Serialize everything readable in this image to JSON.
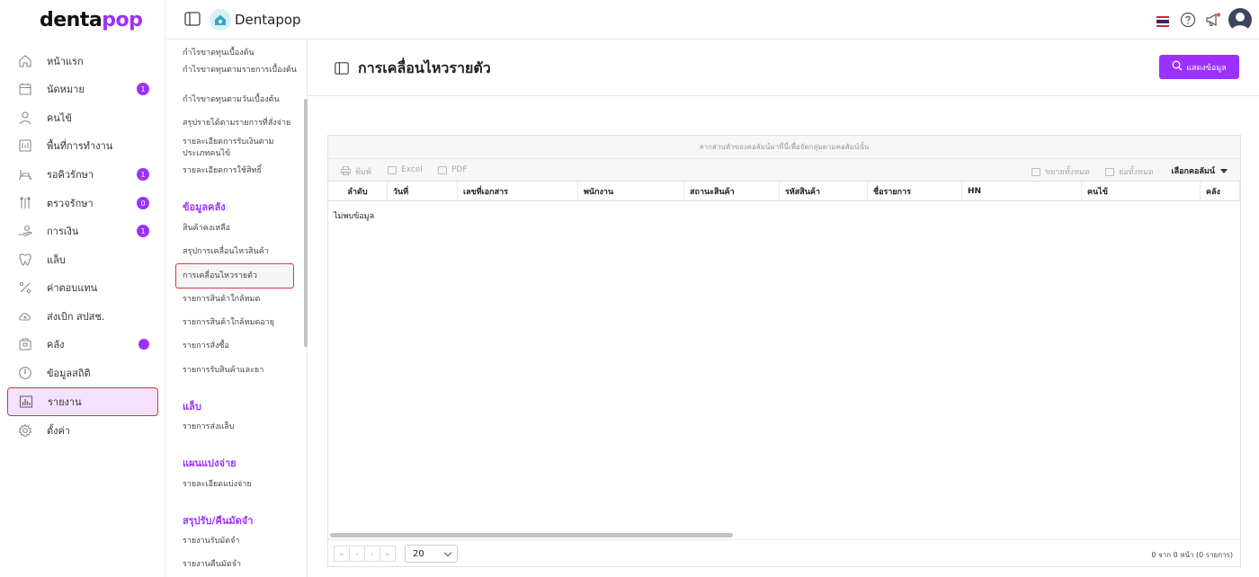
{
  "sidebar": {
    "logo_text_prefix": "denta",
    "logo_text_suffix": "pop",
    "items": [
      {
        "label": "หน้าแรก",
        "icon": "home-icon"
      },
      {
        "label": "นัดหมาย",
        "icon": "calendar-icon",
        "badge": "1"
      },
      {
        "label": "คนไข้",
        "icon": "user-icon"
      },
      {
        "label": "พื้นที่การทำงาน",
        "icon": "workspace-icon"
      },
      {
        "label": "รอคิวรักษา",
        "icon": "dental-chair-icon",
        "badge": "1"
      },
      {
        "label": "ตรวจรักษา",
        "icon": "dental-tools-icon",
        "badge": "0"
      },
      {
        "label": "การเงิน",
        "icon": "payment-hand-icon",
        "badge": "1"
      },
      {
        "label": "แล็บ",
        "icon": "tooth-icon"
      },
      {
        "label": "ค่าตอบแทน",
        "icon": "percent-icon"
      },
      {
        "label": "ส่งเบิก สปสช.",
        "icon": "cloud-upload-icon"
      },
      {
        "label": "คลัง",
        "icon": "warehouse-box-icon"
      },
      {
        "label": "ข้อมูลสถิติ",
        "icon": "gauge-icon"
      },
      {
        "label": "รายงาน",
        "icon": "bar-chart-icon"
      },
      {
        "label": "ตั้งค่า",
        "icon": "gear-icon"
      }
    ]
  },
  "header": {
    "brand_name": "Dentapop"
  },
  "submenu": {
    "links_top": [
      "กำไรขาดทุนเบื้องต้น",
      "กำไรขาดทุนตามรายการเบื้องต้น",
      "กำไรขาดทุนตามวันเบื้องต้น",
      "สรุปรายได้ตามรายการที่สั่งจ่าย",
      "รายละเอียดการรับเงินตามประเภทคนไข้",
      "รายละเอียดการใช้สิทธิ์"
    ],
    "section_inventory": "ข้อมูลคลัง",
    "links_inventory": [
      "สินค้าคงเหลือ",
      "สรุปการเคลื่อนไหวสินค้า",
      "การเคลื่อนไหวรายตัว",
      "รายการสินค้าใกล้หมด",
      "รายการสินค้าใกล้หมดอายุ",
      "รายการสั่งซื้อ",
      "รายการรับสินค้าและยา"
    ],
    "section_lab": "แล็บ",
    "links_lab": [
      "รายการส่งแล็บ"
    ],
    "section_installment": "แผนแบ่งจ่าย",
    "links_installment": [
      "รายละเอียดแบ่งจ่าย"
    ],
    "section_deposit": "สรุปรับ/คืนมัดจำ",
    "links_deposit": [
      "รายงานรับมัดจำ",
      "รายงานคืนมัดจำ"
    ]
  },
  "main": {
    "page_title": "การเคลื่อนไหวรายตัว",
    "show_button": "แสดงข้อมูล"
  },
  "grid": {
    "group_panel_hint": "ลากส่วนหัวของคอลัมน์มาที่นี่เพื่อจัดกลุ่มตามคอลัมน์นั้น",
    "toolbar": {
      "print": "พิมพ์",
      "excel": "Excel",
      "pdf": "PDF",
      "expand_all": "ขยายทั้งหมด",
      "collapse_all": "ย่อทั้งหมด",
      "choose_columns": "เลือกคอลัมน์"
    },
    "columns": [
      "ลำดับ",
      "วันที่",
      "เลขที่เอกสาร",
      "พนักงาน",
      "สถานะสินค้า",
      "รหัสสินค้า",
      "ชื่อรายการ",
      "HN",
      "คนไข้",
      "คลัง"
    ],
    "no_data": "ไม่พบข้อมูล",
    "pager": {
      "page_size": "20",
      "info": "0 จาก 0 หน้า (0 รายการ)"
    }
  },
  "colors": {
    "accent": "#9b30ff",
    "highlight_border": "#d9343a",
    "active_bg": "#f3e1ff"
  }
}
